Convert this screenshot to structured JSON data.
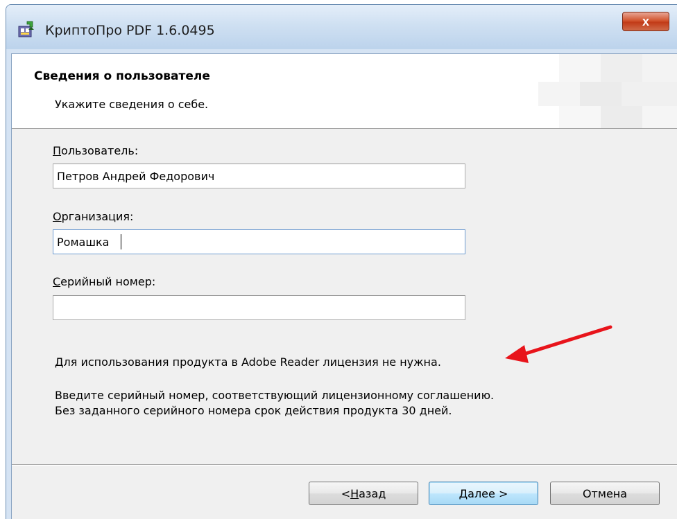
{
  "window": {
    "title": "КриптоПро PDF 1.6.0495",
    "close_symbol": "x"
  },
  "header": {
    "title": "Сведения о пользователе",
    "subtitle": "Укажите сведения о себе."
  },
  "form": {
    "user": {
      "label_accel": "П",
      "label_rest": "ользователь:",
      "value": "Петров Андрей Федорович"
    },
    "organization": {
      "label_accel": "О",
      "label_rest": "рганизация:",
      "value": "Ромашка"
    },
    "serial": {
      "label_accel": "С",
      "label_rest": "ерийный номер:",
      "value": ""
    }
  },
  "info": {
    "license_note": "Для использования продукта в Adobe Reader лицензия не нужна.",
    "serial_line1": "Введите серийный номер, соответствующий лицензионному соглашению.",
    "serial_line2": "Без заданного серийного номера срок действия продукта 30 дней."
  },
  "buttons": {
    "back_prefix": "< ",
    "back_accel": "Н",
    "back_rest": "азад",
    "next_accel": "Д",
    "next_rest": "алее >",
    "cancel": "Отмена"
  },
  "icons": {
    "app_icon": "installer-package-icon",
    "annotation_arrow": "red-arrow-icon"
  },
  "colors": {
    "arrow": "#e8141b",
    "default_button_border": "#3c7fb1"
  }
}
